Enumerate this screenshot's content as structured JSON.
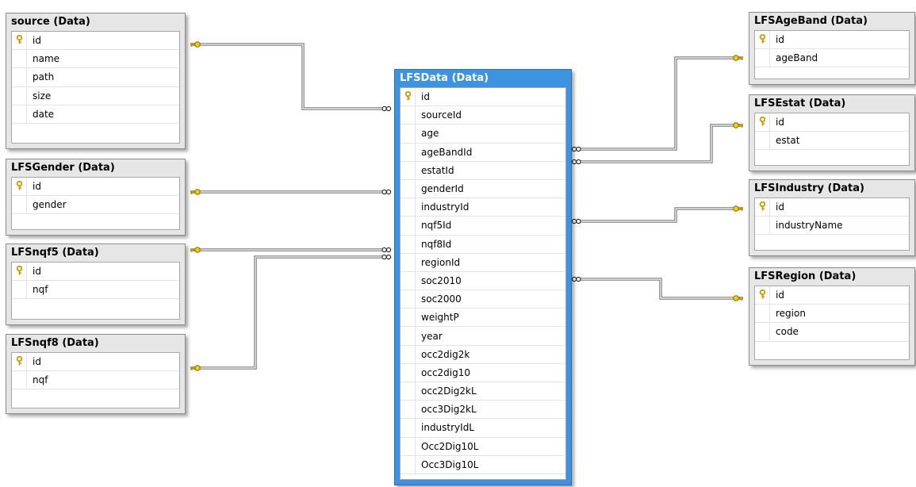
{
  "entities": [
    {
      "id": "source",
      "title": "source (Data)",
      "columns": [
        {
          "name": "id",
          "pk": true
        },
        {
          "name": "name"
        },
        {
          "name": "path"
        },
        {
          "name": "size"
        },
        {
          "name": "date"
        }
      ]
    },
    {
      "id": "LFSGender",
      "title": "LFSGender (Data)",
      "columns": [
        {
          "name": "id",
          "pk": true
        },
        {
          "name": "gender"
        }
      ]
    },
    {
      "id": "LFSnqf5",
      "title": "LFSnqf5 (Data)",
      "columns": [
        {
          "name": "id",
          "pk": true
        },
        {
          "name": "nqf"
        }
      ]
    },
    {
      "id": "LFSnqf8",
      "title": "LFSnqf8 (Data)",
      "columns": [
        {
          "name": "id",
          "pk": true
        },
        {
          "name": "nqf"
        }
      ]
    },
    {
      "id": "LFSData",
      "title": "LFSData (Data)",
      "selected": true,
      "columns": [
        {
          "name": "id",
          "pk": true
        },
        {
          "name": "sourceId"
        },
        {
          "name": "age"
        },
        {
          "name": "ageBandId"
        },
        {
          "name": "estatId"
        },
        {
          "name": "genderId"
        },
        {
          "name": "industryId"
        },
        {
          "name": "nqf5Id"
        },
        {
          "name": "nqf8Id"
        },
        {
          "name": "regionId"
        },
        {
          "name": "soc2010"
        },
        {
          "name": "soc2000"
        },
        {
          "name": "weightP"
        },
        {
          "name": "year"
        },
        {
          "name": "occ2dig2k"
        },
        {
          "name": "occ2dig10"
        },
        {
          "name": "occ2Dig2kL"
        },
        {
          "name": "occ3Dig2kL"
        },
        {
          "name": "industryIdL"
        },
        {
          "name": "Occ2Dig10L"
        },
        {
          "name": "Occ3Dig10L"
        }
      ]
    },
    {
      "id": "LFSAgeBand",
      "title": "LFSAgeBand (Data)",
      "columns": [
        {
          "name": "id",
          "pk": true
        },
        {
          "name": "ageBand"
        }
      ]
    },
    {
      "id": "LFSEstat",
      "title": "LFSEstat (Data)",
      "columns": [
        {
          "name": "id",
          "pk": true
        },
        {
          "name": "estat"
        }
      ]
    },
    {
      "id": "LFSIndustry",
      "title": "LFSIndustry (Data)",
      "columns": [
        {
          "name": "id",
          "pk": true
        },
        {
          "name": "industryName"
        }
      ]
    },
    {
      "id": "LFSRegion",
      "title": "LFSRegion (Data)",
      "columns": [
        {
          "name": "id",
          "pk": true
        },
        {
          "name": "region"
        },
        {
          "name": "code"
        }
      ]
    }
  ],
  "relationships": [
    {
      "from": "LFSData",
      "to": "source"
    },
    {
      "from": "LFSData",
      "to": "LFSGender"
    },
    {
      "from": "LFSData",
      "to": "LFSnqf5"
    },
    {
      "from": "LFSData",
      "to": "LFSnqf8"
    },
    {
      "from": "LFSData",
      "to": "LFSAgeBand"
    },
    {
      "from": "LFSData",
      "to": "LFSEstat"
    },
    {
      "from": "LFSData",
      "to": "LFSIndustry"
    },
    {
      "from": "LFSData",
      "to": "LFSRegion"
    }
  ],
  "icons": {
    "primary_key": "key-icon",
    "many_end": "infinity-icon",
    "one_end": "key-icon"
  },
  "colors": {
    "selected_header": "#3e93e0",
    "entity_background": "#e6e6e6",
    "connector": "#707070",
    "key": "#d4a800"
  }
}
